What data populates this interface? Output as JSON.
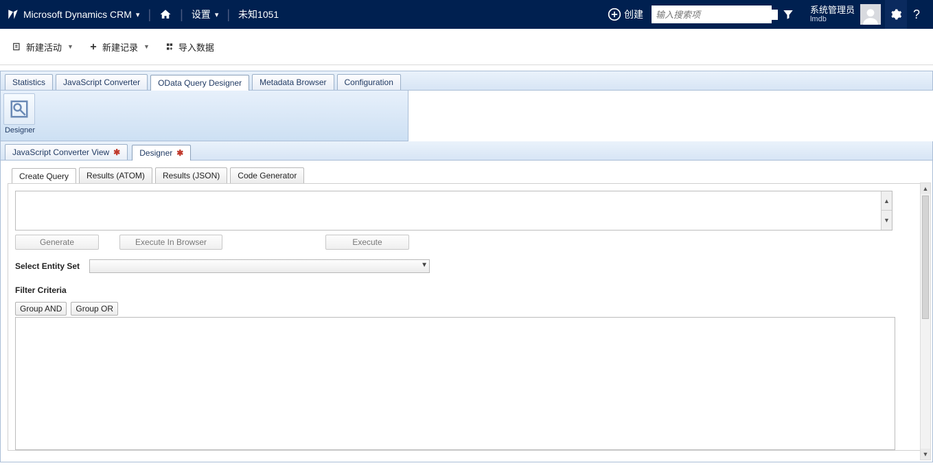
{
  "topnav": {
    "brand": "Microsoft Dynamics CRM",
    "settings": "设置",
    "unknown": "未知1051",
    "create": "创建",
    "search_placeholder": "输入搜索项",
    "user_name": "系统管理员",
    "user_org": "lmdb"
  },
  "cmdbar": {
    "new_activity": "新建活动",
    "new_record": "新建记录",
    "import_data": "导入数据"
  },
  "tabs_main": {
    "statistics": "Statistics",
    "js_converter": "JavaScript Converter",
    "odata_designer": "OData Query Designer",
    "metadata_browser": "Metadata Browser",
    "configuration": "Configuration"
  },
  "ribbon": {
    "designer": "Designer"
  },
  "tabs_views": {
    "js_converter_view": "JavaScript Converter View",
    "designer": "Designer"
  },
  "tabs_designer": {
    "create_query": "Create Query",
    "results_atom": "Results (ATOM)",
    "results_json": "Results (JSON)",
    "code_generator": "Code Generator"
  },
  "buttons": {
    "generate": "Generate",
    "execute_browser": "Execute In Browser",
    "execute": "Execute",
    "group_and": "Group AND",
    "group_or": "Group OR"
  },
  "labels": {
    "select_entity_set": "Select Entity Set",
    "filter_criteria": "Filter Criteria"
  }
}
